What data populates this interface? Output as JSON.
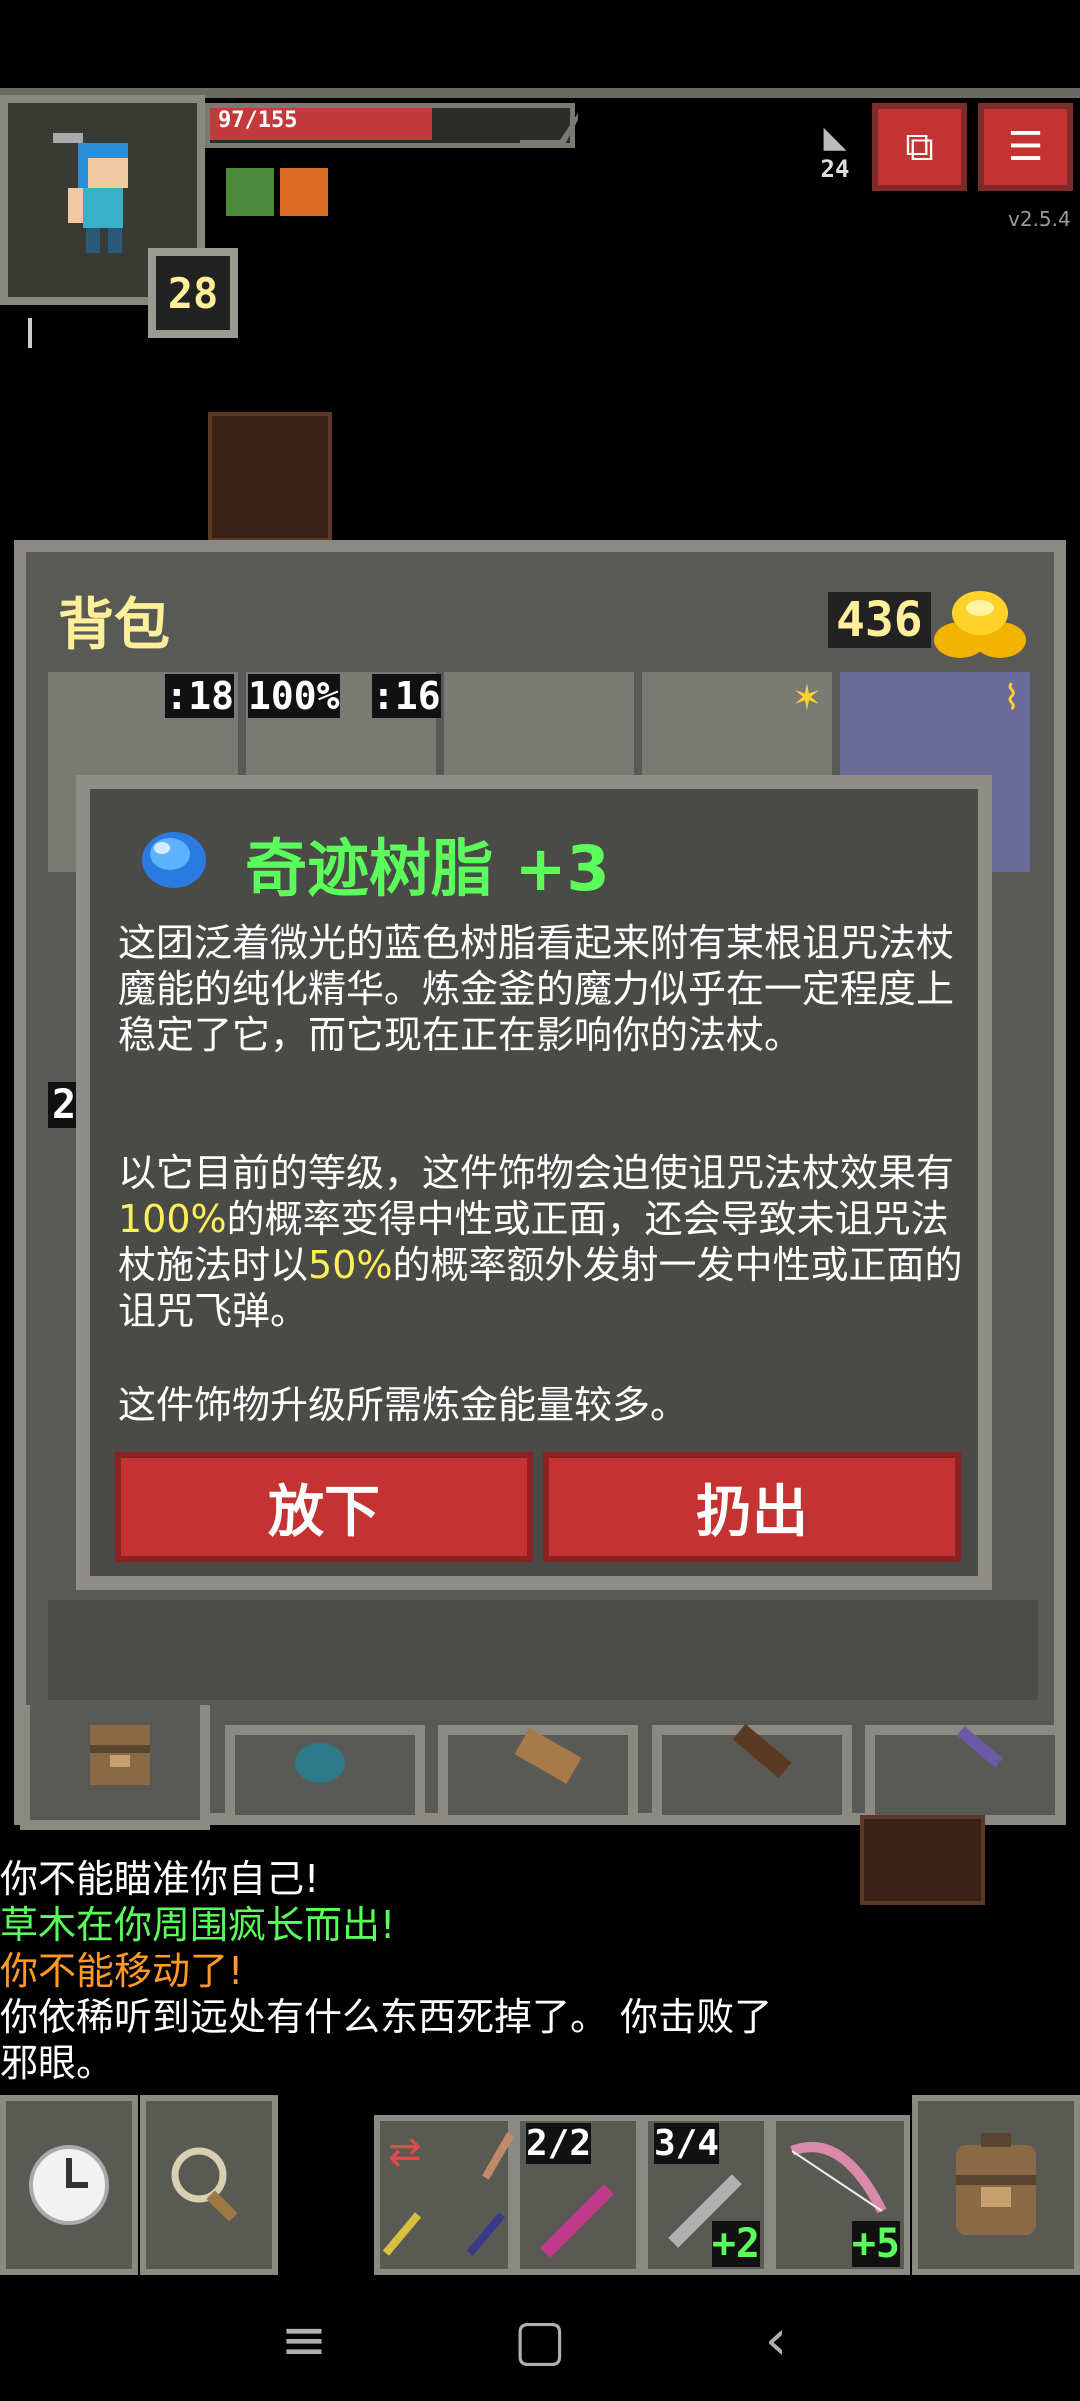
{
  "hud": {
    "hp_text": "97/155",
    "hp_fraction": 0.626,
    "level": "28",
    "depth": "24",
    "version": "v2.5.4"
  },
  "bag": {
    "title": "背包",
    "gold": "436",
    "slot_labels": [
      ":18",
      "100%",
      ":16"
    ]
  },
  "item": {
    "name": "奇迹树脂 +3",
    "desc_p1": "这团泛着微光的蓝色树脂看起来附有某根诅咒法杖魔能的纯化精华。炼金釜的魔力似乎在一定程度上稳定了它，而它现在正在影响你的法杖。",
    "desc_p2a": "以它目前的等级，这件饰物会迫使诅咒法杖效果有",
    "desc_p2_hl1": "100%",
    "desc_p2b": "的概率变得中性或正面，还会导致未诅咒法杖施法时以",
    "desc_p2_hl2": "50%",
    "desc_p2c": "的概率额外发射一发中性或正面的诅咒飞弹。",
    "desc_p3": "这件饰物升级所需炼金能量较多。",
    "drop_label": "放下",
    "throw_label": "扔出"
  },
  "side_marker": "2",
  "log": [
    {
      "text": "你不能瞄准你自己!",
      "color": "#ffffff"
    },
    {
      "text": "草木在你周围疯长而出!",
      "color": "#5bff5b"
    },
    {
      "text": "你不能移动了!",
      "color": "#ff9a2a"
    },
    {
      "text": "你依稀听到远处有什么东西死掉了。 你击败了",
      "color": "#ffffff"
    },
    {
      "text": "邪眼。",
      "color": "#ffffff"
    }
  ],
  "quickslots": {
    "slot1_count": "2/2",
    "slot2_count": "3/4",
    "slot2_bonus": "+2",
    "slot3_bonus": "+5"
  },
  "colors": {
    "panel": "#595955",
    "border": "#8a8a83",
    "button_red": "#c43232",
    "title_green": "#5bff5b",
    "highlight_yellow": "#ffef5a"
  }
}
